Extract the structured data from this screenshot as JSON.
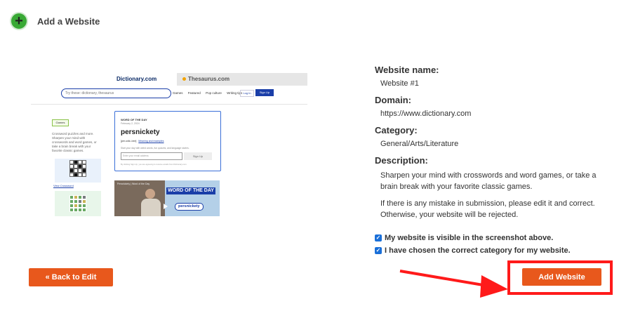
{
  "header": {
    "title": "Add a Website",
    "icon": "plus-circle-icon",
    "accent": "#39a935"
  },
  "preview": {
    "tabs": [
      "Dictionary.com",
      "Thesaurus.com"
    ],
    "search_placeholder": "Try these: dictionary, thesaurus",
    "nav_links": [
      "Games",
      "Featured",
      "Pop culture",
      "Writing tips"
    ],
    "login": "Log In",
    "signup": "Sign Up",
    "games_badge": "Games",
    "left_text": "Crossword puzzles and more. Sharpen your mind with crosswords and word games, or take a brain break with your favorite classic games.",
    "view_link": "View Crossword",
    "wotd_label": "WORD OF THE DAY",
    "wotd_date": "February 2, 2024",
    "word": "persnickety",
    "pronunciation": "[per-snik-i-tee]",
    "pron_link": "Meaning and examples",
    "signup_text": "Start your day with weird words, fun quizzes, and language stories.",
    "email_placeholder": "Enter your email address",
    "signup_btn": "Sign Up",
    "fine_print": "By clicking Sign Up, you are agreeing to receive emails from Dictionary.com.",
    "video_title": "Persnickety | Word of the Day",
    "video_tag": "WORD OF THE DAY",
    "video_word": "persnickety"
  },
  "info": {
    "name_label": "Website name:",
    "name_value": "Website #1",
    "domain_label": "Domain:",
    "domain_value": "https://www.dictionary.com",
    "category_label": "Category:",
    "category_value": "General/Arts/Literature",
    "description_label": "Description:",
    "description_value": "Sharpen your mind with crosswords and word games, or take a brain break with your favorite classic games.",
    "warning": "If there is any mistake in submission, please edit it and correct. Otherwise, your website will be rejected."
  },
  "checks": [
    {
      "label": "My website is visible in the screenshot above.",
      "checked": true
    },
    {
      "label": "I have chosen the correct category for my website.",
      "checked": true
    }
  ],
  "buttons": {
    "back": "« Back to Edit",
    "add": "Add Website",
    "color": "#e8581c"
  },
  "annotation": {
    "highlight_color": "#ff1a1a"
  }
}
